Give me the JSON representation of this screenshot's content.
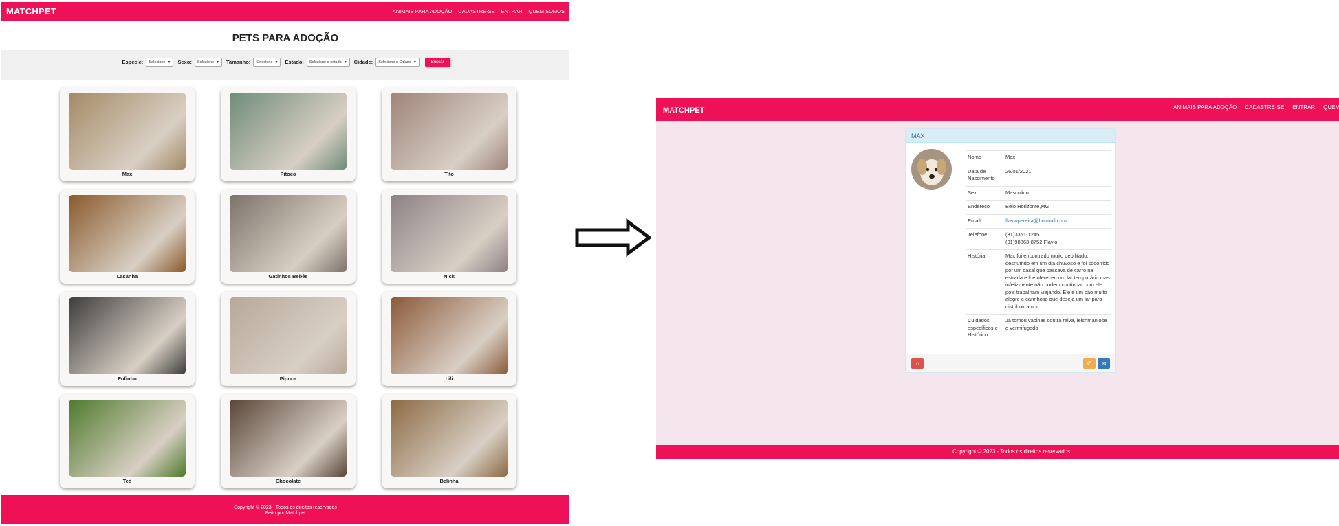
{
  "left": {
    "brand": "MATCHPET",
    "nav": [
      "ANIMAIS PARA ADOÇÃO",
      "CADASTRE-SE",
      "ENTRAR",
      "QUEM SOMOS"
    ],
    "title": "PETS PARA ADOÇÃO",
    "filters": {
      "especie": {
        "label": "Espécie:",
        "value": "Selecione"
      },
      "sexo": {
        "label": "Sexo:",
        "value": "Selecione"
      },
      "tamanho": {
        "label": "Tamanho:",
        "value": "Selecione"
      },
      "estado": {
        "label": "Estado:",
        "value": "Selecione o estado"
      },
      "cidade": {
        "label": "Cidade:",
        "value": "Selecione a Cidade"
      },
      "buscar": "Buscar"
    },
    "pets": [
      {
        "name": "Max",
        "color": "#a48a66"
      },
      {
        "name": "Pitoco",
        "color": "#6f8c7a"
      },
      {
        "name": "Tito",
        "color": "#9f857b"
      },
      {
        "name": "Lasanha",
        "color": "#8a5a2c"
      },
      {
        "name": "Gatinhos Bebês",
        "color": "#7c746b"
      },
      {
        "name": "Nick",
        "color": "#8c8286"
      },
      {
        "name": "Fofinho",
        "color": "#3d3d3d"
      },
      {
        "name": "Pipoca",
        "color": "#b7a99a"
      },
      {
        "name": "Lili",
        "color": "#8c5a3a"
      },
      {
        "name": "Ted",
        "color": "#4f7a2c"
      },
      {
        "name": "Chocolate",
        "color": "#5a4639"
      },
      {
        "name": "Belinha",
        "color": "#8c6a44"
      }
    ],
    "footer": {
      "line1": "Copyright © 2023 - Todos os direitos reservados",
      "line2": "Feito por Matchpet"
    }
  },
  "right": {
    "brand": "MATCHPET",
    "nav": [
      "ANIMAIS PARA ADOÇÃO",
      "CADASTRE-SE",
      "ENTRAR",
      "QUEM SOMOS"
    ],
    "panel_title": "MAX",
    "fields": [
      {
        "k": "Nome",
        "v": "Max"
      },
      {
        "k": "Data de Nascimento",
        "v": "26/01/2021"
      },
      {
        "k": "Sexo",
        "v": "Masculino"
      },
      {
        "k": "Endereço",
        "v": "Belo Horizonte,MG"
      },
      {
        "k": "Email",
        "v": "flaviopereira@hotmail.com"
      },
      {
        "k": "Telefone",
        "v": "(31)3351-1245\n(31)98863-8752 Flávio"
      },
      {
        "k": "História",
        "v": "Max foi encontrado muito debilitado, desnutrido em um dia chuvoso e foi socorrido por um casal que passava de carro na estrada e lhe ofereceu um lar temporário mas infelizmente não podem continuar com ele pois trabalham viajando. Ele é um cão muito alegre e carinhoso que deseja um lar para distribuir amor"
      },
      {
        "k": "Cuidados específicos e Histórico",
        "v": "Já tomou vacinas contra raiva, leishmaniose e vermifugado"
      }
    ],
    "footer": "Copyright © 2023 - Todos os direitos reservados",
    "colors": {
      "home": "#d9534f",
      "phone": "#f0ad4e",
      "mail": "#337ab7"
    }
  }
}
